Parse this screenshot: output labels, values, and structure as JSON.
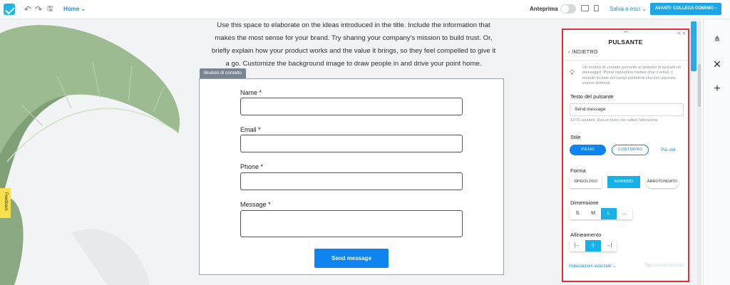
{
  "topbar": {
    "page_selector": "Home",
    "preview_label": "Anteprima",
    "save_exit": "Salva e esci",
    "next_button": "AVANTI: COLLEGA DOMINIO"
  },
  "hero": {
    "paragraph": "Use this space to elaborate on the ideas introduced in the title. Include the information that makes the most sense for your brand. Try sharing your company's mission to build trust. Or, briefly explain how your product works and the value it brings, so they feel compelled to give it a go. Customize the background image to draw people in and drive your point home."
  },
  "form": {
    "tag": "Modulo di contatto",
    "fields": [
      {
        "label": "Name *"
      },
      {
        "label": "Email *"
      },
      {
        "label": "Phone *"
      },
      {
        "label": "Message *"
      }
    ],
    "submit": "Send message"
  },
  "feedback_tab": "Feedback",
  "panel": {
    "title": "PULSANTE",
    "back": "INDIETRO",
    "info": "Un modulo di contatto permette ai visitatori di lasciarti un messaggio. Potrai rispondere tramite chat o email. Il modulo include dei campi predefiniti che non possono essere eliminati.",
    "button_text_label": "Testo del pulsante",
    "button_text_value": "Send message",
    "char_hint": "12/70 caratteri. Usa un testo che catturi l'attenzione.",
    "style_label": "Stile",
    "style_options": [
      "PIENO",
      "CONTORNO"
    ],
    "style_selected": "PIENO",
    "more_styles": "Più stili",
    "shape_label": "Forma",
    "shape_options": [
      "SPIGOLOSO",
      "MORBIDO",
      "ARROTONDATO"
    ],
    "shape_selected": "MORBIDO",
    "size_label": "Dimensione",
    "size_options": [
      "S",
      "M",
      "L",
      "..."
    ],
    "size_selected": "L",
    "align_label": "Allineamento",
    "align_options": [
      "|←",
      "-|-",
      "→|"
    ],
    "align_selected": "-|-",
    "advanced_settings": "Impostazioni avanzate",
    "reset_default": "Ripristina predefinito"
  },
  "colors": {
    "accent": "#0d84f0",
    "active": "#17b1ea",
    "highlight_border": "#e1303c"
  }
}
